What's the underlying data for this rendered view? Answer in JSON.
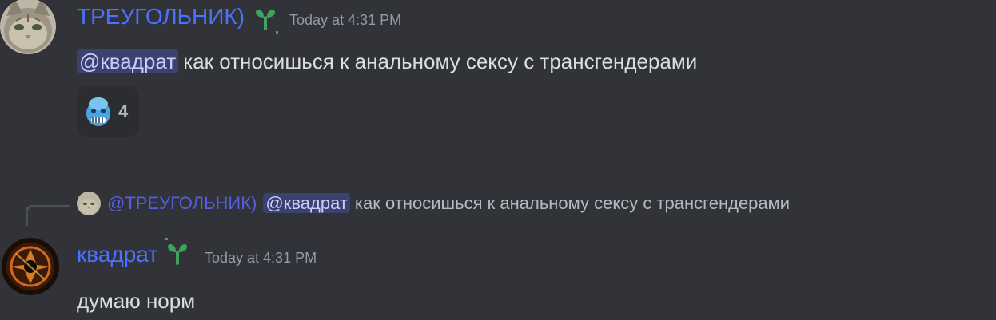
{
  "messages": [
    {
      "author": "ТРЕУГОЛЬНИК)",
      "author_color": "#4a72ff",
      "timestamp": "Today at 4:31 PM",
      "mention": "@квадрат",
      "text": "как относишься к анальному сексу с трансгендерами",
      "reaction": {
        "emoji_icon": "cold-face-icon",
        "count": "4"
      }
    },
    {
      "reply_to": {
        "author": "@ТРЕУГОЛЬНИК)",
        "mention": "@квадрат",
        "text": "как относишься к анальному сексу с трансгендерами"
      },
      "author": "квадрат",
      "author_color": "#4a72ff",
      "timestamp": "Today at 4:31 PM",
      "text": "думаю норм"
    }
  ],
  "colors": {
    "background": "#313338",
    "mention_bg": "#3c4270",
    "badge_green": "#2ecc71"
  }
}
